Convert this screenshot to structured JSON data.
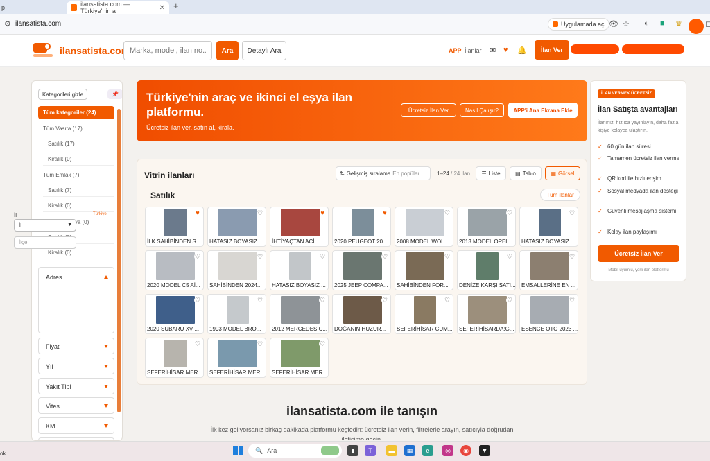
{
  "browser": {
    "left_tab_fragment": "p",
    "active_tab_title": "ilansatista.com — Türkiye'nin a",
    "url": "ilansatista.com",
    "open_in_app": "Uygulamada aç"
  },
  "header": {
    "logo_text": "ilansatista.com",
    "search_placeholder": "Marka, model, ilan no...",
    "search_button": "Ara",
    "detail_search": "Detaylı Ara",
    "app_link": "APP",
    "listings_link": "İlanlar",
    "post_ad": "İlan Ver"
  },
  "sidebar": {
    "hide_categories": "Kategorileri gizle",
    "categories": [
      {
        "label": "Tüm kategoriler (24)",
        "active": true
      },
      {
        "label": "Tüm Vasıta (17)"
      },
      {
        "label": "Satılık (17)"
      },
      {
        "label": "Kiralık (0)"
      },
      {
        "label": "Tüm Emlak (7)"
      },
      {
        "label": "Satılık (7)"
      },
      {
        "label": "Kiralık (0)"
      },
      {
        "label": "Tüm 2. El Eşya (0)"
      },
      {
        "label": "Satılık (0)"
      },
      {
        "label": "Kiralık (0)"
      }
    ],
    "address": {
      "title": "Adres",
      "province_label": "İl",
      "country": "Türkiye",
      "province_value": "İl",
      "district_placeholder": "İlçe"
    },
    "filters": [
      "Fiyat",
      "Yıl",
      "Yakıt Tipi",
      "Vites",
      "KM"
    ]
  },
  "hero": {
    "title": "Türkiye'nin araç ve ikinci el eşya ilan platformu.",
    "subtitle": "Ücretsiz ilan ver, satın al, kirala.",
    "btn_free": "Ücretsiz İlan Ver",
    "btn_how": "Nasıl Çalışır?",
    "btn_app": "APP'i Ana Ekrana Ekle"
  },
  "showcase": {
    "title": "Vitrin ilanları",
    "sort_label": "Gelişmiş sıralama",
    "sort_value": "En popüler",
    "count_range": "1–24",
    "count_total": "/ 24 ilan",
    "view_list": "Liste",
    "view_table": "Tablo",
    "view_grid": "Görsel",
    "section": "Satılık",
    "all_listings": "Tüm ilanlar",
    "listings": [
      {
        "title": "İLK SAHİBİNDEN S...",
        "fav": true,
        "color": "#6b7a8c"
      },
      {
        "title": "HATASIZ BOYASIZ ...",
        "fav": false,
        "color": "#8a9bb0"
      },
      {
        "title": "İHTİYAÇTAN ACİL ...",
        "fav": true,
        "color": "#a8473f"
      },
      {
        "title": "2020 PEUGEOT 20...",
        "fav": true,
        "color": "#7c8e9a"
      },
      {
        "title": "2008 MODEL WOL...",
        "fav": false,
        "color": "#c9ced4"
      },
      {
        "title": "2013 MODEL OPEL...",
        "fav": false,
        "color": "#9aa3a8"
      },
      {
        "title": "HATASIZ BOYASIZ ...",
        "fav": false,
        "color": "#5a6f86"
      },
      {
        "title": "2020 MODEL C5 Aİ...",
        "fav": false,
        "color": "#b8bcc2"
      },
      {
        "title": "SAHİBİNDEN 2024...",
        "fav": false,
        "color": "#d8d6d2"
      },
      {
        "title": "HATASIZ BOYASIZ ...",
        "fav": false,
        "color": "#c2c6c9"
      },
      {
        "title": "2025 JEEP COMPA...",
        "fav": false,
        "color": "#6a7670"
      },
      {
        "title": "SAHİBİNDEN FOR...",
        "fav": false,
        "color": "#7a6a55"
      },
      {
        "title": "DENİZE KARŞI SATI...",
        "fav": false,
        "color": "#5f7d6a"
      },
      {
        "title": "EMSALLERİNE EN ...",
        "fav": false,
        "color": "#8c7f70"
      },
      {
        "title": "2020 SUBARU XV ...",
        "fav": false,
        "color": "#3f5f8a"
      },
      {
        "title": "1993 MODEL BRO...",
        "fav": false,
        "color": "#c5c9cc"
      },
      {
        "title": "2012 MERCEDES C...",
        "fav": false,
        "color": "#8e9397"
      },
      {
        "title": "DOĞANIN HUZUR...",
        "fav": false,
        "color": "#6d5a48"
      },
      {
        "title": "SEFERİHİSAR CUM...",
        "fav": false,
        "color": "#8a7a62"
      },
      {
        "title": "SEFERİHİSARDA;G...",
        "fav": false,
        "color": "#9c8f7c"
      },
      {
        "title": "ESENCE OTO 2023 ...",
        "fav": false,
        "color": "#a7acb2"
      },
      {
        "title": "SEFERİHİSAR MER...",
        "fav": false,
        "color": "#b7b4ad"
      },
      {
        "title": "SEFERİHİSAR MER...",
        "fav": false,
        "color": "#7a99ad"
      },
      {
        "title": "SEFERİHİSAR MER...",
        "fav": false,
        "color": "#7f9a6a"
      }
    ]
  },
  "right_panel": {
    "badge": "İLAN VERMEK ÜCRETSİZ",
    "title": "İlan Satışta avantajları",
    "desc": "İlanınızı hızlıca yayınlayın, daha fazla kişiye kolayca ulaştırın.",
    "benefits": [
      "60 gün ilan süresi",
      "Tamamen ücretsiz ilan verme",
      "QR kod ile hızlı erişim",
      "Sosyal medyada ilan desteği",
      "Güvenli mesajlaşma sistemi",
      "Kolay ilan paylaşımı"
    ],
    "cta": "Ücretsiz İlan Ver",
    "footer": "Mobil uyumlu, yerli ilan platformu"
  },
  "intro": {
    "title": "ilansatista.com ile tanışın",
    "text": "İlk kez geliyorsanız birkaç dakikada platformu keşfedin: ücretsiz ilan verin, filtrelerle arayın, satıcıyla doğrudan iletişime geçin."
  },
  "taskbar": {
    "search": "Ara",
    "left_fragment": "ok"
  },
  "colors": {
    "brand": "#f15a00",
    "hero_start": "#f04d00",
    "hero_end": "#ff7a1a"
  }
}
